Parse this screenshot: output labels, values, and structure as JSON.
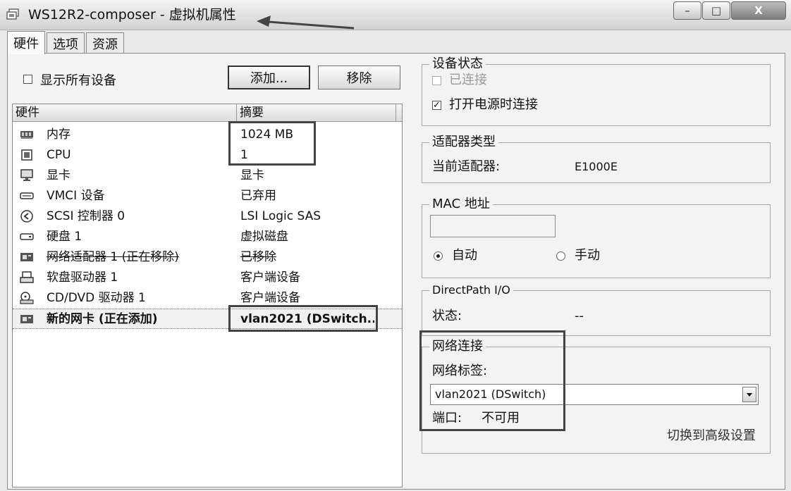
{
  "window": {
    "title": "WS12R2-composer - 虚拟机属性",
    "min_label": "–",
    "max_label": "□",
    "close_label": "X"
  },
  "tabs": [
    {
      "label": "硬件",
      "active": true
    },
    {
      "label": "选项",
      "active": false
    },
    {
      "label": "资源",
      "active": false
    }
  ],
  "hardware_tab": {
    "show_all_label": "显示所有设备",
    "show_all_checked": false,
    "add_label": "添加...",
    "remove_label": "移除",
    "columns": [
      "硬件",
      "摘要"
    ],
    "rows": [
      {
        "icon": "memory-icon",
        "name": "内存",
        "summary": "1024 MB"
      },
      {
        "icon": "cpu-icon",
        "name": "CPU",
        "summary": "1"
      },
      {
        "icon": "display-icon",
        "name": "显卡",
        "summary": "显卡"
      },
      {
        "icon": "vmci-icon",
        "name": "VMCI 设备",
        "summary": "已弃用"
      },
      {
        "icon": "scsi-icon",
        "name": "SCSI 控制器 0",
        "summary": "LSI Logic SAS"
      },
      {
        "icon": "disk-icon",
        "name": "硬盘 1",
        "summary": "虚拟磁盘"
      },
      {
        "icon": "nic-icon",
        "name": "网络适配器 1 (正在移除)",
        "summary": "已移除"
      },
      {
        "icon": "floppy-icon",
        "name": "软盘驱动器 1",
        "summary": "客户端设备"
      },
      {
        "icon": "cdrom-icon",
        "name": "CD/DVD 驱动器 1",
        "summary": "客户端设备"
      },
      {
        "icon": "nic-icon",
        "name": "新的网卡 (正在添加)",
        "summary": "vlan2021 (DSwitch..."
      }
    ]
  },
  "device_status": {
    "title": "设备状态",
    "connected_label": "已连接",
    "connected_checked": false,
    "connect_on_power_label": "打开电源时连接",
    "connect_on_power_checked": true
  },
  "adapter_type": {
    "title": "适配器类型",
    "current_label": "当前适配器:",
    "current_value": "E1000E"
  },
  "mac_address": {
    "title": "MAC 地址",
    "value": "",
    "auto_label": "自动",
    "manual_label": "手动",
    "selected": "auto"
  },
  "directpath": {
    "title": "DirectPath I/O",
    "status_label": "状态:",
    "status_value": "--"
  },
  "network_connection": {
    "title": "网络连接",
    "label_label": "网络标签:",
    "selected_network": "vlan2021 (DSwitch)",
    "port_label": "端口:",
    "port_value": "不可用",
    "advanced_link": "切换到高级设置"
  }
}
